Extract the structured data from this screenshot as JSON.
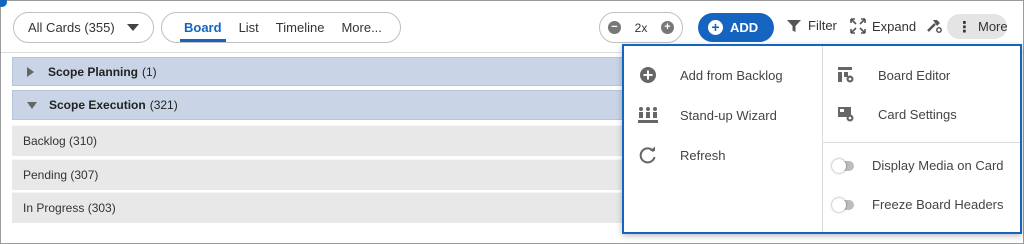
{
  "toolbar": {
    "card_filter": "All Cards (355)",
    "tabs": [
      "Board",
      "List",
      "Timeline",
      "More..."
    ],
    "zoom_level": "2x",
    "add_label": "ADD",
    "filter_label": "Filter",
    "expand_label": "Expand",
    "more_label": "More"
  },
  "board": {
    "groups": [
      {
        "name": "Scope Planning",
        "count": "(1)",
        "expanded": false
      },
      {
        "name": "Scope Execution",
        "count": "(321)",
        "expanded": true
      }
    ],
    "lanes": [
      "Backlog (310)",
      "Pending (307)",
      "In Progress (303)"
    ]
  },
  "more_menu": {
    "left_items": [
      "Add from Backlog",
      "Stand-up Wizard",
      "Refresh"
    ],
    "right_items": [
      "Board Editor",
      "Card Settings"
    ],
    "toggles": [
      {
        "label": "Display Media on Card",
        "on": false
      },
      {
        "label": "Freeze Board Headers",
        "on": false
      }
    ]
  },
  "colors": {
    "accent": "#1565c0",
    "group_row_bg": "#c9d5e6",
    "lane_bg": "#e8e8e8"
  }
}
